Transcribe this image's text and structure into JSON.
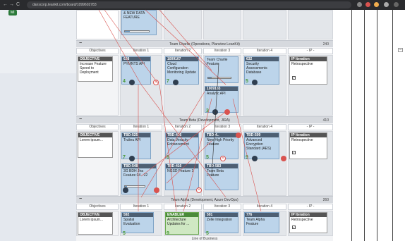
{
  "browser": {
    "url": "danscorp.leankit.com/board/1099602783",
    "back": "←",
    "forward": "→",
    "reload": "C"
  },
  "left_strip": {
    "label": "MI"
  },
  "top_card": {
    "title": "& NEW DATA FEATURE"
  },
  "teams": [
    {
      "name": "Team Charlie (Operations, Planview LeanKit)",
      "count": "240",
      "columns": [
        "Objectives",
        "Iteration 1",
        "Iteration 2",
        "Iteration 3",
        "Iteration 4",
        "- IP -"
      ],
      "objective": {
        "head": "OBJECTIVE",
        "text": "Increase Feature Speed to Deployment"
      },
      "cards": [
        {
          "id": "638",
          "title": "PYMNTS API",
          "points": "4"
        },
        {
          "id": "1009107",
          "title": "Cloud Configuration Monitoring Update",
          "points": "7"
        },
        {
          "id": "Team Charlie Feature",
          "title": "",
          "points": ""
        },
        {
          "id": "632",
          "title": "Security Assessments Database",
          "points": "5"
        },
        {
          "id": "1009183",
          "title": "Analytic API",
          "points": "3"
        }
      ],
      "ip": {
        "head": "IP Iteration",
        "text": "Retrospective"
      }
    },
    {
      "name": "Team Beta (Development, JIRA)",
      "count": "410",
      "columns": [
        "Objectives",
        "Iteration 1",
        "Iteration 2",
        "Iteration 3",
        "Iteration 4",
        "- IP -"
      ],
      "objective": {
        "head": "OBJECTIVE",
        "text": "Lorem ipsum..."
      },
      "cards": [
        {
          "id": "TBD-525",
          "title": "Trulieu API",
          "points": "7"
        },
        {
          "id": "TBD-436",
          "title": "Data Veracity Enhancement",
          "points": "6"
        },
        {
          "id": "TBD-4..",
          "title": "New High Priority Feature",
          "points": "5"
        },
        {
          "id": "TBD-509",
          "title": "Advanced Encryption Standard (AES)",
          "points": "9"
        },
        {
          "id": "TBD-548",
          "title": "3G BDH Jira Feature 04 - 22",
          "points": ""
        },
        {
          "id": "TBD-416",
          "title": "NGSD Feature 1",
          "points": ""
        },
        {
          "id": "TBD-583",
          "title": "Team Beta Feature",
          "points": ""
        }
      ],
      "ip": {
        "head": "IP Iteration",
        "text": "Retrospective"
      }
    },
    {
      "name": "Team Alpha (Development, Azure DevOps)",
      "count": "260",
      "columns": [
        "Objectives",
        "Iteration 1",
        "Iteration 2",
        "Iteration 3",
        "Iteration 4",
        "- IP -"
      ],
      "objective": {
        "head": "OBJECTIVE",
        "text": "Lorem ipsum..."
      },
      "cards": [
        {
          "id": "592",
          "title": "Spatial Evaluation",
          "points": "5"
        },
        {
          "id": "ENABLER",
          "title": "Architecture Updates for ...",
          "points": "9"
        },
        {
          "id": "591",
          "title": "Zelle Integration",
          "points": "5"
        },
        {
          "id": "776",
          "title": "Team Alpha Feature",
          "points": ""
        }
      ],
      "ip": {
        "head": "IP Iteration",
        "text": "Retrospective"
      }
    }
  ],
  "footer": {
    "label": "Line of Business"
  },
  "colors": {
    "accent": "#4d5f73",
    "dependency_line": "#d9534f",
    "green": "#3a8a3a"
  }
}
